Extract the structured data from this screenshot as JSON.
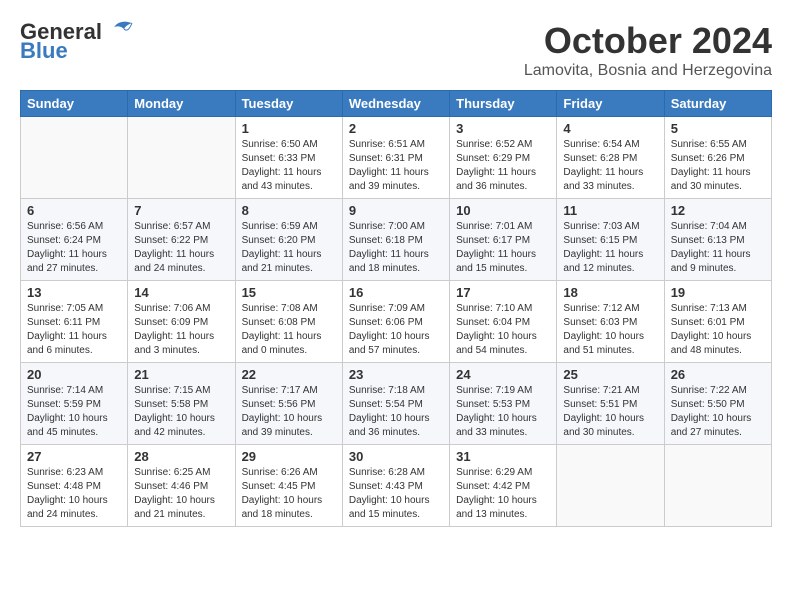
{
  "header": {
    "logo_line1": "General",
    "logo_line2": "Blue",
    "month": "October 2024",
    "location": "Lamovita, Bosnia and Herzegovina"
  },
  "days_of_week": [
    "Sunday",
    "Monday",
    "Tuesday",
    "Wednesday",
    "Thursday",
    "Friday",
    "Saturday"
  ],
  "weeks": [
    [
      {
        "day": "",
        "info": ""
      },
      {
        "day": "",
        "info": ""
      },
      {
        "day": "1",
        "info": "Sunrise: 6:50 AM\nSunset: 6:33 PM\nDaylight: 11 hours and 43 minutes."
      },
      {
        "day": "2",
        "info": "Sunrise: 6:51 AM\nSunset: 6:31 PM\nDaylight: 11 hours and 39 minutes."
      },
      {
        "day": "3",
        "info": "Sunrise: 6:52 AM\nSunset: 6:29 PM\nDaylight: 11 hours and 36 minutes."
      },
      {
        "day": "4",
        "info": "Sunrise: 6:54 AM\nSunset: 6:28 PM\nDaylight: 11 hours and 33 minutes."
      },
      {
        "day": "5",
        "info": "Sunrise: 6:55 AM\nSunset: 6:26 PM\nDaylight: 11 hours and 30 minutes."
      }
    ],
    [
      {
        "day": "6",
        "info": "Sunrise: 6:56 AM\nSunset: 6:24 PM\nDaylight: 11 hours and 27 minutes."
      },
      {
        "day": "7",
        "info": "Sunrise: 6:57 AM\nSunset: 6:22 PM\nDaylight: 11 hours and 24 minutes."
      },
      {
        "day": "8",
        "info": "Sunrise: 6:59 AM\nSunset: 6:20 PM\nDaylight: 11 hours and 21 minutes."
      },
      {
        "day": "9",
        "info": "Sunrise: 7:00 AM\nSunset: 6:18 PM\nDaylight: 11 hours and 18 minutes."
      },
      {
        "day": "10",
        "info": "Sunrise: 7:01 AM\nSunset: 6:17 PM\nDaylight: 11 hours and 15 minutes."
      },
      {
        "day": "11",
        "info": "Sunrise: 7:03 AM\nSunset: 6:15 PM\nDaylight: 11 hours and 12 minutes."
      },
      {
        "day": "12",
        "info": "Sunrise: 7:04 AM\nSunset: 6:13 PM\nDaylight: 11 hours and 9 minutes."
      }
    ],
    [
      {
        "day": "13",
        "info": "Sunrise: 7:05 AM\nSunset: 6:11 PM\nDaylight: 11 hours and 6 minutes."
      },
      {
        "day": "14",
        "info": "Sunrise: 7:06 AM\nSunset: 6:09 PM\nDaylight: 11 hours and 3 minutes."
      },
      {
        "day": "15",
        "info": "Sunrise: 7:08 AM\nSunset: 6:08 PM\nDaylight: 11 hours and 0 minutes."
      },
      {
        "day": "16",
        "info": "Sunrise: 7:09 AM\nSunset: 6:06 PM\nDaylight: 10 hours and 57 minutes."
      },
      {
        "day": "17",
        "info": "Sunrise: 7:10 AM\nSunset: 6:04 PM\nDaylight: 10 hours and 54 minutes."
      },
      {
        "day": "18",
        "info": "Sunrise: 7:12 AM\nSunset: 6:03 PM\nDaylight: 10 hours and 51 minutes."
      },
      {
        "day": "19",
        "info": "Sunrise: 7:13 AM\nSunset: 6:01 PM\nDaylight: 10 hours and 48 minutes."
      }
    ],
    [
      {
        "day": "20",
        "info": "Sunrise: 7:14 AM\nSunset: 5:59 PM\nDaylight: 10 hours and 45 minutes."
      },
      {
        "day": "21",
        "info": "Sunrise: 7:15 AM\nSunset: 5:58 PM\nDaylight: 10 hours and 42 minutes."
      },
      {
        "day": "22",
        "info": "Sunrise: 7:17 AM\nSunset: 5:56 PM\nDaylight: 10 hours and 39 minutes."
      },
      {
        "day": "23",
        "info": "Sunrise: 7:18 AM\nSunset: 5:54 PM\nDaylight: 10 hours and 36 minutes."
      },
      {
        "day": "24",
        "info": "Sunrise: 7:19 AM\nSunset: 5:53 PM\nDaylight: 10 hours and 33 minutes."
      },
      {
        "day": "25",
        "info": "Sunrise: 7:21 AM\nSunset: 5:51 PM\nDaylight: 10 hours and 30 minutes."
      },
      {
        "day": "26",
        "info": "Sunrise: 7:22 AM\nSunset: 5:50 PM\nDaylight: 10 hours and 27 minutes."
      }
    ],
    [
      {
        "day": "27",
        "info": "Sunrise: 6:23 AM\nSunset: 4:48 PM\nDaylight: 10 hours and 24 minutes."
      },
      {
        "day": "28",
        "info": "Sunrise: 6:25 AM\nSunset: 4:46 PM\nDaylight: 10 hours and 21 minutes."
      },
      {
        "day": "29",
        "info": "Sunrise: 6:26 AM\nSunset: 4:45 PM\nDaylight: 10 hours and 18 minutes."
      },
      {
        "day": "30",
        "info": "Sunrise: 6:28 AM\nSunset: 4:43 PM\nDaylight: 10 hours and 15 minutes."
      },
      {
        "day": "31",
        "info": "Sunrise: 6:29 AM\nSunset: 4:42 PM\nDaylight: 10 hours and 13 minutes."
      },
      {
        "day": "",
        "info": ""
      },
      {
        "day": "",
        "info": ""
      }
    ]
  ]
}
